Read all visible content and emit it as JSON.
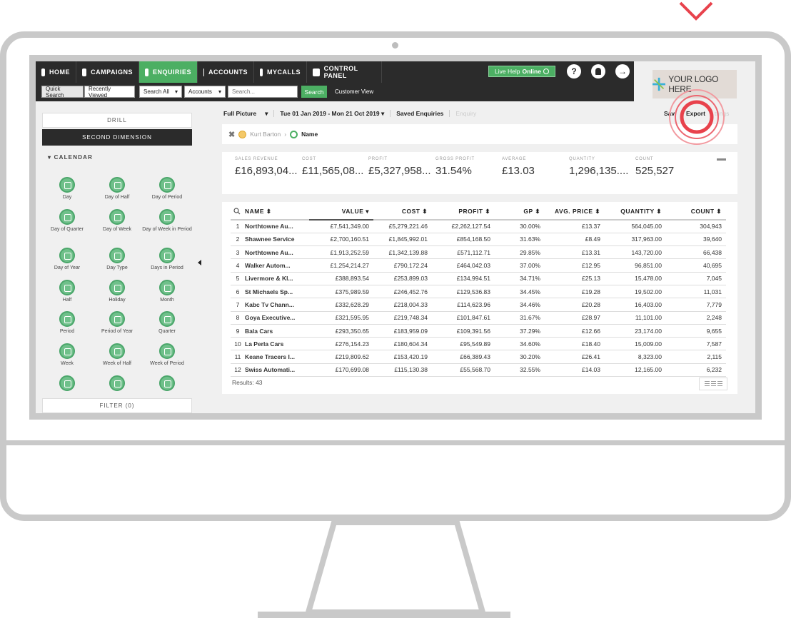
{
  "nav": {
    "items": [
      {
        "label": "HOME",
        "icon": "home-icon"
      },
      {
        "label": "CAMPAIGNS",
        "icon": "campaigns-icon"
      },
      {
        "label": "ENQUIRIES",
        "icon": "enquiries-icon"
      },
      {
        "label": "ACCOUNTS",
        "icon": "bank-icon"
      },
      {
        "label": "MYCALLS",
        "icon": "mycalls-icon"
      },
      {
        "label": "CONTROL PANEL",
        "icon": "control-panel-icon"
      }
    ],
    "live_help": "Live Help",
    "live_help_status": "Online",
    "help": "?",
    "accent": "#4caf63"
  },
  "subbar": {
    "quick_search": "Quick Search",
    "recently_viewed": "Recently Viewed",
    "search_all": "Search All",
    "accounts": "Accounts",
    "search_placeholder": "Search...",
    "search_button": "Search",
    "customer_view": "Customer View"
  },
  "logo": {
    "text": "YOUR LOGO HERE"
  },
  "sidebar": {
    "drill": "DRILL",
    "second_dimension": "SECOND DIMENSION",
    "calendar": "CALENDAR",
    "dimensions": [
      "Day",
      "Day of Half",
      "Day of Period",
      "Day of Quarter",
      "Day of Week",
      "Day of Week in Period",
      "Day of Year",
      "Day Type",
      "Days in Period",
      "Half",
      "Holiday",
      "Month",
      "Period",
      "Period of Year",
      "Quarter",
      "Week",
      "Week of Half",
      "Week of Period",
      "",
      "",
      ""
    ],
    "filter": "FILTER (0)"
  },
  "toolbar": {
    "full_picture": "Full Picture",
    "date_range": "Tue 01 Jan 2019 - Mon 21 Oct 2019",
    "saved_enquiries": "Saved Enquiries",
    "enquiry": "Enquiry",
    "save": "Sav",
    "export": "Export",
    "settings": "ttings"
  },
  "drill_path": {
    "first": "Kurt Barton",
    "second": "Name"
  },
  "kpis": [
    {
      "label": "SALES REVENUE",
      "value": "£16,893,04..."
    },
    {
      "label": "COST",
      "value": "£11,565,08..."
    },
    {
      "label": "PROFIT",
      "value": "£5,327,958..."
    },
    {
      "label": "GROSS PROFIT",
      "value": "31.54%"
    },
    {
      "label": "AVERAGE",
      "value": "£13.03"
    },
    {
      "label": "QUANTITY",
      "value": "1,296,135...."
    },
    {
      "label": "COUNT",
      "value": "525,527"
    }
  ],
  "table": {
    "headers": [
      "NAME ⬍",
      "VALUE ▾",
      "COST ⬍",
      "PROFIT ⬍",
      "GP ⬍",
      "AVG. PRICE ⬍",
      "QUANTITY ⬍",
      "COUNT ⬍"
    ],
    "rows": [
      [
        "1",
        "Northtowne Au...",
        "£7,541,349.00",
        "£5,279,221.46",
        "£2,262,127.54",
        "30.00%",
        "£13.37",
        "564,045.00",
        "304,943"
      ],
      [
        "2",
        "Shawnee Service",
        "£2,700,160.51",
        "£1,845,992.01",
        "£854,168.50",
        "31.63%",
        "£8.49",
        "317,963.00",
        "39,640"
      ],
      [
        "3",
        "Northtowne Au...",
        "£1,913,252.59",
        "£1,342,139.88",
        "£571,112.71",
        "29.85%",
        "£13.31",
        "143,720.00",
        "66,438"
      ],
      [
        "4",
        "Walker Autom...",
        "£1,254,214.27",
        "£790,172.24",
        "£464,042.03",
        "37.00%",
        "£12.95",
        "96,851.00",
        "40,695"
      ],
      [
        "5",
        "Livermore & Kl...",
        "£388,893.54",
        "£253,899.03",
        "£134,994.51",
        "34.71%",
        "£25.13",
        "15,478.00",
        "7,045"
      ],
      [
        "6",
        "St Michaels Sp...",
        "£375,989.59",
        "£246,452.76",
        "£129,536.83",
        "34.45%",
        "£19.28",
        "19,502.00",
        "11,031"
      ],
      [
        "7",
        "Kabc Tv Chann...",
        "£332,628.29",
        "£218,004.33",
        "£114,623.96",
        "34.46%",
        "£20.28",
        "16,403.00",
        "7,779"
      ],
      [
        "8",
        "Goya Executive...",
        "£321,595.95",
        "£219,748.34",
        "£101,847.61",
        "31.67%",
        "£28.97",
        "11,101.00",
        "2,248"
      ],
      [
        "9",
        "Bala Cars",
        "£293,350.65",
        "£183,959.09",
        "£109,391.56",
        "37.29%",
        "£12.66",
        "23,174.00",
        "9,655"
      ],
      [
        "10",
        "La Perla Cars",
        "£276,154.23",
        "£180,604.34",
        "£95,549.89",
        "34.60%",
        "£18.40",
        "15,009.00",
        "7,587"
      ],
      [
        "11",
        "Keane Tracers I...",
        "£219,809.62",
        "£153,420.19",
        "£66,389.43",
        "30.20%",
        "£26.41",
        "8,323.00",
        "2,115"
      ],
      [
        "12",
        "Swiss Automati...",
        "£170,699.08",
        "£115,130.38",
        "£55,568.70",
        "32.55%",
        "£14.03",
        "12,165.00",
        "6,232"
      ]
    ],
    "results": "Results: 43"
  }
}
